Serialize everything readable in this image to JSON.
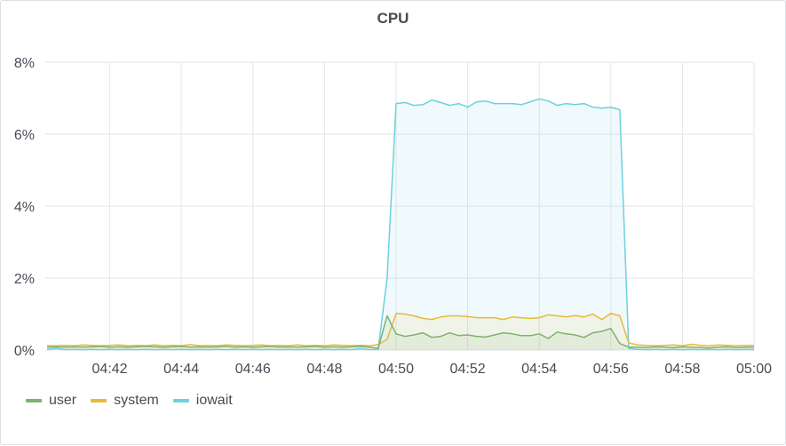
{
  "panel": {
    "title": "CPU"
  },
  "chart_data": {
    "type": "area",
    "title": "CPU",
    "xlabel": "",
    "ylabel": "",
    "ylim": [
      0,
      8
    ],
    "y_unit": "%",
    "y_ticks": [
      "0%",
      "2%",
      "4%",
      "6%",
      "8%"
    ],
    "y_tick_values": [
      0,
      2,
      4,
      6,
      8
    ],
    "x_ticks": [
      "04:42",
      "04:44",
      "04:46",
      "04:48",
      "04:50",
      "04:52",
      "04:54",
      "04:56",
      "04:58",
      "05:00"
    ],
    "x_tick_minutes": [
      2,
      4,
      6,
      8,
      10,
      12,
      14,
      16,
      18,
      20
    ],
    "x_range_minutes": [
      0.2,
      20
    ],
    "x_origin_time": "04:40",
    "sample_interval_seconds": 15,
    "grid": true,
    "legend_position": "bottom-left",
    "series": [
      {
        "name": "user",
        "color": "#7eb26d",
        "values": [
          0.08,
          0.09,
          0.08,
          0.09,
          0.08,
          0.09,
          0.1,
          0.08,
          0.09,
          0.08,
          0.09,
          0.1,
          0.09,
          0.08,
          0.09,
          0.1,
          0.08,
          0.09,
          0.08,
          0.09,
          0.1,
          0.08,
          0.09,
          0.08,
          0.09,
          0.1,
          0.08,
          0.09,
          0.08,
          0.09,
          0.1,
          0.08,
          0.09,
          0.08,
          0.09,
          0.1,
          0.08,
          0.05,
          0.95,
          0.45,
          0.38,
          0.42,
          0.48,
          0.35,
          0.38,
          0.48,
          0.4,
          0.42,
          0.38,
          0.36,
          0.42,
          0.48,
          0.45,
          0.4,
          0.4,
          0.45,
          0.32,
          0.5,
          0.45,
          0.42,
          0.35,
          0.48,
          0.52,
          0.6,
          0.18,
          0.08,
          0.08,
          0.07,
          0.09,
          0.08,
          0.07,
          0.09,
          0.08,
          0.07,
          0.06,
          0.08,
          0.09,
          0.07,
          0.08,
          0.08
        ]
      },
      {
        "name": "system",
        "color": "#eab839",
        "values": [
          0.12,
          0.12,
          0.13,
          0.12,
          0.14,
          0.13,
          0.12,
          0.13,
          0.14,
          0.12,
          0.13,
          0.12,
          0.14,
          0.12,
          0.13,
          0.12,
          0.15,
          0.12,
          0.13,
          0.12,
          0.14,
          0.13,
          0.12,
          0.13,
          0.14,
          0.12,
          0.13,
          0.12,
          0.14,
          0.12,
          0.13,
          0.12,
          0.14,
          0.13,
          0.12,
          0.13,
          0.12,
          0.15,
          0.3,
          1.02,
          1.0,
          0.95,
          0.88,
          0.85,
          0.92,
          0.95,
          0.95,
          0.93,
          0.9,
          0.9,
          0.9,
          0.85,
          0.92,
          0.9,
          0.88,
          0.9,
          0.98,
          0.95,
          0.92,
          0.96,
          0.92,
          1.0,
          0.85,
          1.02,
          0.95,
          0.2,
          0.14,
          0.13,
          0.12,
          0.13,
          0.14,
          0.12,
          0.16,
          0.13,
          0.12,
          0.14,
          0.13,
          0.12,
          0.13,
          0.13
        ]
      },
      {
        "name": "iowait",
        "color": "#6ed0e0",
        "values": [
          0.02,
          0.05,
          0.01,
          0.02,
          0.01,
          0.02,
          0.01,
          0.02,
          0.01,
          0.02,
          0.01,
          0.02,
          0.01,
          0.02,
          0.01,
          0.02,
          0.01,
          0.02,
          0.01,
          0.02,
          0.01,
          0.02,
          0.01,
          0.02,
          0.01,
          0.02,
          0.01,
          0.02,
          0.01,
          0.02,
          0.01,
          0.02,
          0.01,
          0.02,
          0.01,
          0.04,
          0.01,
          0.02,
          2.0,
          6.85,
          6.88,
          6.8,
          6.82,
          6.95,
          6.88,
          6.8,
          6.85,
          6.75,
          6.9,
          6.92,
          6.85,
          6.85,
          6.85,
          6.82,
          6.9,
          6.98,
          6.92,
          6.8,
          6.85,
          6.82,
          6.85,
          6.75,
          6.72,
          6.75,
          6.68,
          0.05,
          0.02,
          0.01,
          0.02,
          0.01,
          0.02,
          0.01,
          0.02,
          0.01,
          0.02,
          0.01,
          0.02,
          0.01,
          0.02,
          0.01
        ]
      }
    ]
  },
  "legend": {
    "items": [
      {
        "label": "user",
        "color": "#7eb26d"
      },
      {
        "label": "system",
        "color": "#eab839"
      },
      {
        "label": "iowait",
        "color": "#6ed0e0"
      }
    ]
  }
}
